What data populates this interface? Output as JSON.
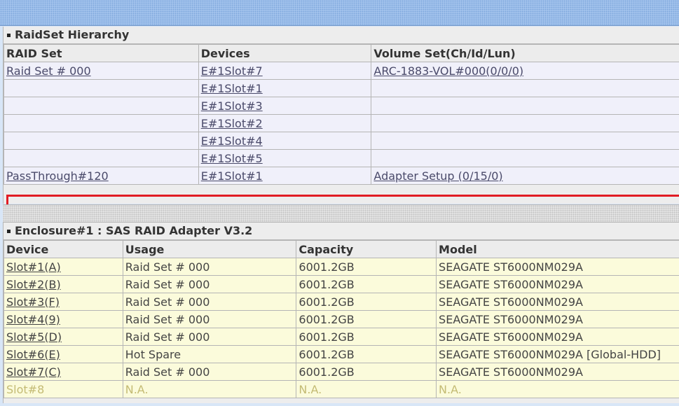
{
  "raidset_panel": {
    "title": "RaidSet Hierarchy",
    "headers": [
      "RAID Set",
      "Devices",
      "Volume Set(Ch/Id/Lun)"
    ],
    "rows": [
      {
        "raid_set": "Raid Set # 000",
        "device": "E#1Slot#7",
        "volume": "ARC-1883-VOL#000(0/0/0)"
      },
      {
        "raid_set": "",
        "device": "E#1Slot#1",
        "volume": ""
      },
      {
        "raid_set": "",
        "device": "E#1Slot#3",
        "volume": ""
      },
      {
        "raid_set": "",
        "device": "E#1Slot#2",
        "volume": ""
      },
      {
        "raid_set": "",
        "device": "E#1Slot#4",
        "volume": ""
      },
      {
        "raid_set": "",
        "device": "E#1Slot#5",
        "volume": ""
      },
      {
        "raid_set": "PassThrough#120",
        "device": "E#1Slot#1",
        "volume": "Adapter Setup (0/15/0)"
      }
    ]
  },
  "enclosure_panel": {
    "title": "Enclosure#1 : SAS RAID Adapter V3.2",
    "headers": [
      "Device",
      "Usage",
      "Capacity",
      "Model"
    ],
    "rows": [
      {
        "device": "Slot#1(A)",
        "usage": "Raid Set # 000",
        "capacity": "6001.2GB",
        "model": "SEAGATE ST6000NM029A"
      },
      {
        "device": "Slot#2(B)",
        "usage": "Raid Set # 000",
        "capacity": "6001.2GB",
        "model": "SEAGATE ST6000NM029A"
      },
      {
        "device": "Slot#3(F)",
        "usage": "Raid Set # 000",
        "capacity": "6001.2GB",
        "model": "SEAGATE ST6000NM029A"
      },
      {
        "device": "Slot#4(9)",
        "usage": "Raid Set # 000",
        "capacity": "6001.2GB",
        "model": "SEAGATE ST6000NM029A"
      },
      {
        "device": "Slot#5(D)",
        "usage": "Raid Set # 000",
        "capacity": "6001.2GB",
        "model": "SEAGATE ST6000NM029A"
      },
      {
        "device": "Slot#6(E)",
        "usage": "Hot Spare",
        "capacity": "6001.2GB",
        "model": "SEAGATE ST6000NM029A [Global-HDD]"
      },
      {
        "device": "Slot#7(C)",
        "usage": "Raid Set # 000",
        "capacity": "6001.2GB",
        "model": "SEAGATE ST6000NM029A"
      },
      {
        "device": "Slot#8",
        "usage": "N.A.",
        "capacity": "N.A.",
        "model": "N.A."
      }
    ]
  },
  "colors": {
    "highlight_border": "#e11c24",
    "enclosure_row_bg": "#fbfbdb",
    "raidset_row_bg": "#f0f0fa",
    "na_text": "#c4bb74"
  }
}
